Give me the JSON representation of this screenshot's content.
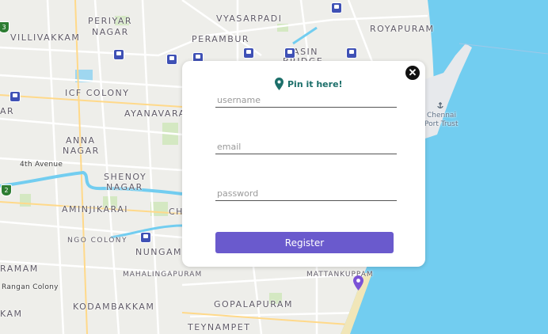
{
  "map": {
    "labels": {
      "periyar": "PERIYAR",
      "nagar": "NAGAR",
      "vyasarpadi": "VYASARPADI",
      "royapuram": "ROYAPURAM",
      "villivakkam": "VILLIVAKKAM",
      "perambur": "PERAMBUR",
      "basin": "BASIN",
      "bridge": "BRIDGE",
      "icf_colony": "ICF COLONY",
      "ayanavaram": "AYANAVARA",
      "anna": "ANNA",
      "anna_nagar": "NAGAR",
      "fourth_avenue": "4th Avenue",
      "shenoy": "SHENOY",
      "shenoy_nagar": "NAGAR",
      "aminjikarai": "AMINJIKARAI",
      "ch": "CH",
      "ngo_colony": "NGO COLONY",
      "nungambakkam": "NUNGAMB",
      "ramam": "RAMAM",
      "mahalingapuram": "MAHALINGAPURAM",
      "mattankuppam": "MATTANKUPPAM",
      "rangan_colony": "Rangan Colony",
      "kodambakkam": "KODAMBAKKAM",
      "gopalapuram": "GOPALAPURAM",
      "kam": "KAM",
      "teynampet": "TEYNAMPET",
      "ar": "AR",
      "chennai": "Chennai",
      "port_trust": "Port Trust"
    },
    "route_shield_1": "3",
    "route_shield_2": "2",
    "route_shield_color": "#2d7d32",
    "sea_color": "#72cdf0",
    "land_color": "#eeeeea",
    "park_color": "#d4e8c2",
    "rail_icon_color": "#3f51b5",
    "marker_color": "#7b52d6"
  },
  "modal": {
    "close_icon": "close-icon",
    "title_icon": "map-pin-icon",
    "title": "Pin it here!",
    "title_color": "#1c6f6a",
    "username_placeholder": "username",
    "email_placeholder": "email",
    "password_placeholder": "password",
    "register_label": "Register",
    "button_color": "#6a5acd"
  }
}
